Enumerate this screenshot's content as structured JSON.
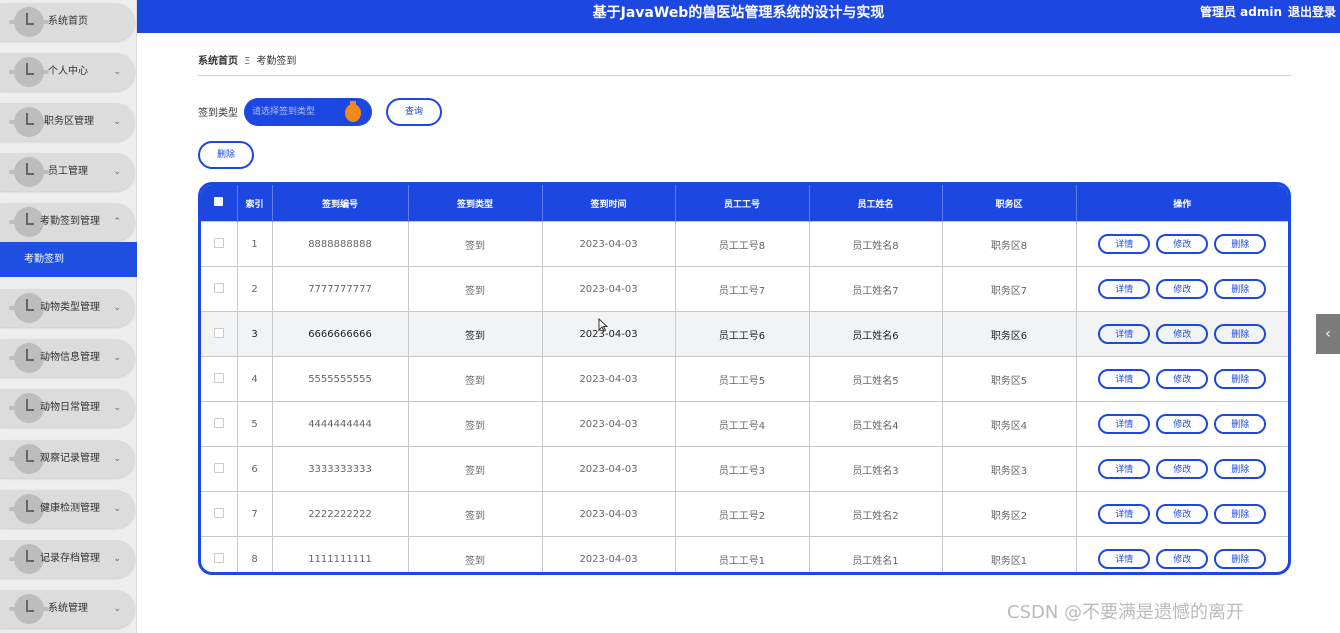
{
  "header": {
    "title": "基于JavaWeb的兽医站管理系统的设计与实现",
    "user": "管理员 admin",
    "logout": "退出登录",
    "accent": "#1c47e0"
  },
  "sidebar": {
    "items": [
      {
        "label": "系统首页",
        "arrow": ""
      },
      {
        "label": "个人中心",
        "arrow": "⌄"
      },
      {
        "label": "职务区管理",
        "arrow": "⌄"
      },
      {
        "label": "员工管理",
        "arrow": "⌄"
      },
      {
        "label": "考勤签到管理",
        "arrow": "⌃"
      },
      {
        "label": "动物类型管理",
        "arrow": "⌄"
      },
      {
        "label": "动物信息管理",
        "arrow": "⌄"
      },
      {
        "label": "动物日常管理",
        "arrow": "⌄"
      },
      {
        "label": "观察记录管理",
        "arrow": "⌄"
      },
      {
        "label": "健康检测管理",
        "arrow": "⌄"
      },
      {
        "label": "记录存档管理",
        "arrow": "⌄"
      },
      {
        "label": "系统管理",
        "arrow": "⌄"
      }
    ],
    "active_sub": "考勤签到"
  },
  "breadcrumb": {
    "home": "系统首页",
    "sep": "Ξ",
    "current": "考勤签到"
  },
  "search": {
    "label": "签到类型",
    "placeholder": "请选择签到类型",
    "query_button": "查询"
  },
  "toolbar": {
    "delete_button": "删除"
  },
  "table": {
    "columns": [
      "",
      "索引",
      "签到编号",
      "签到类型",
      "签到时间",
      "员工工号",
      "员工姓名",
      "职务区",
      "操作"
    ],
    "actions": [
      "详情",
      "修改",
      "删除"
    ],
    "rows": [
      {
        "index": "1",
        "code": "8888888888",
        "type": "签到",
        "time": "2023-04-03",
        "emp_no": "员工工号8",
        "emp_name": "员工姓名8",
        "zone": "职务区8"
      },
      {
        "index": "2",
        "code": "7777777777",
        "type": "签到",
        "time": "2023-04-03",
        "emp_no": "员工工号7",
        "emp_name": "员工姓名7",
        "zone": "职务区7"
      },
      {
        "index": "3",
        "code": "6666666666",
        "type": "签到",
        "time": "2023-04-03",
        "emp_no": "员工工号6",
        "emp_name": "员工姓名6",
        "zone": "职务区6"
      },
      {
        "index": "4",
        "code": "5555555555",
        "type": "签到",
        "time": "2023-04-03",
        "emp_no": "员工工号5",
        "emp_name": "员工姓名5",
        "zone": "职务区5"
      },
      {
        "index": "5",
        "code": "4444444444",
        "type": "签到",
        "time": "2023-04-03",
        "emp_no": "员工工号4",
        "emp_name": "员工姓名4",
        "zone": "职务区4"
      },
      {
        "index": "6",
        "code": "3333333333",
        "type": "签到",
        "time": "2023-04-03",
        "emp_no": "员工工号3",
        "emp_name": "员工姓名3",
        "zone": "职务区3"
      },
      {
        "index": "7",
        "code": "2222222222",
        "type": "签到",
        "time": "2023-04-03",
        "emp_no": "员工工号2",
        "emp_name": "员工姓名2",
        "zone": "职务区2"
      },
      {
        "index": "8",
        "code": "1111111111",
        "type": "签到",
        "time": "2023-04-03",
        "emp_no": "员工工号1",
        "emp_name": "员工姓名1",
        "zone": "职务区1"
      }
    ]
  },
  "watermark": "CSDN @不要满是遗憾的离开"
}
